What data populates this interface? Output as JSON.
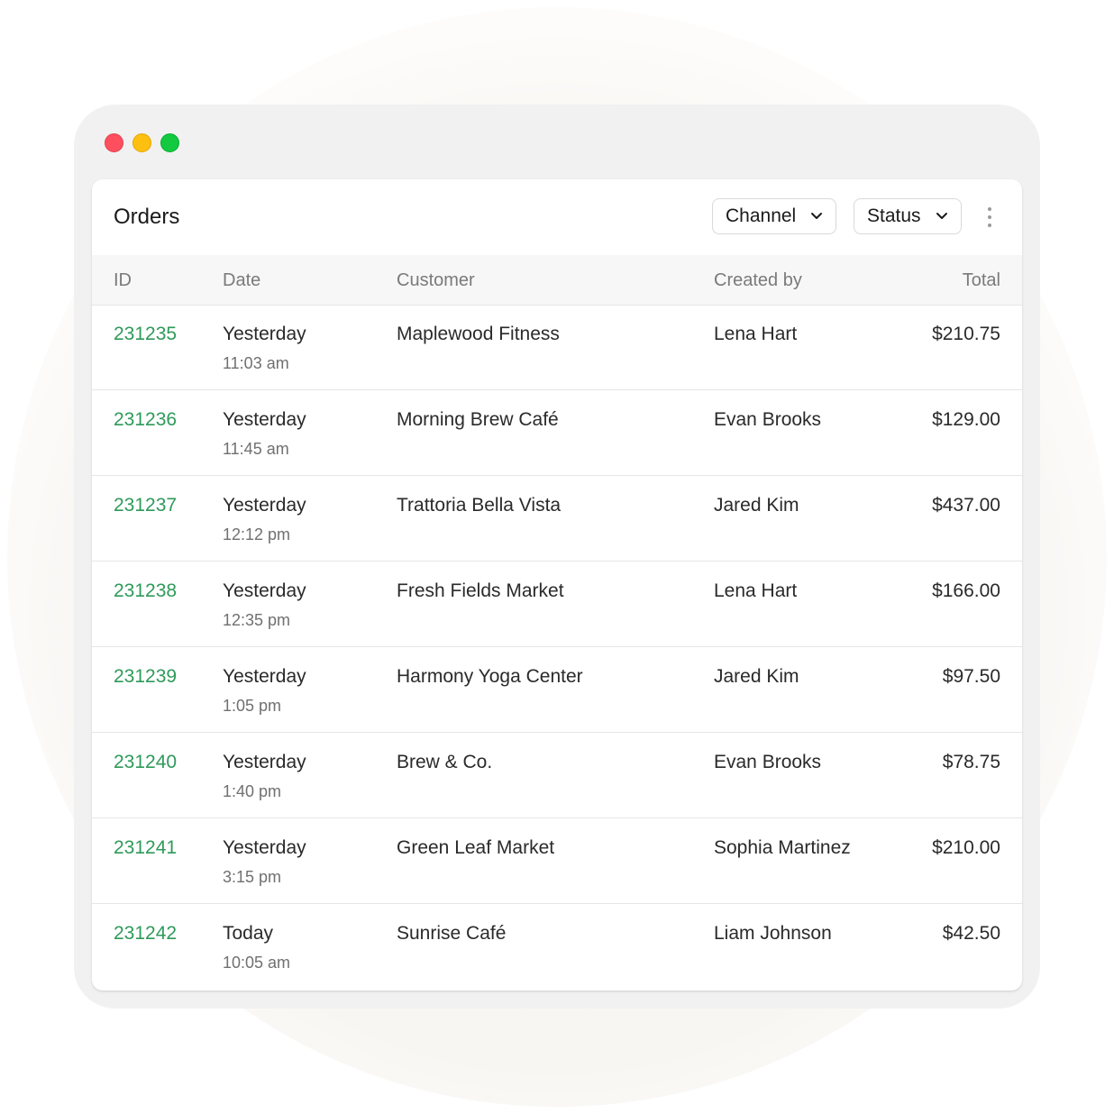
{
  "window": {
    "title": "Orders",
    "accent_color": "#2e9a5a"
  },
  "header": {
    "title": "Orders",
    "filters": [
      {
        "label": "Channel"
      },
      {
        "label": "Status"
      }
    ],
    "more_icon": "kebab-menu-icon"
  },
  "table": {
    "columns": [
      "ID",
      "Date",
      "Customer",
      "Created by",
      "Total"
    ],
    "rows": [
      {
        "id": "231235",
        "date": "Yesterday",
        "time": "11:03 am",
        "customer": "Maplewood Fitness",
        "created_by": "Lena Hart",
        "total": "$210.75"
      },
      {
        "id": "231236",
        "date": "Yesterday",
        "time": "11:45 am",
        "customer": "Morning Brew Café",
        "created_by": "Evan Brooks",
        "total": "$129.00"
      },
      {
        "id": "231237",
        "date": "Yesterday",
        "time": "12:12 pm",
        "customer": "Trattoria Bella Vista",
        "created_by": "Jared Kim",
        "total": "$437.00"
      },
      {
        "id": "231238",
        "date": "Yesterday",
        "time": "12:35 pm",
        "customer": "Fresh Fields Market",
        "created_by": "Lena Hart",
        "total": "$166.00"
      },
      {
        "id": "231239",
        "date": "Yesterday",
        "time": "1:05 pm",
        "customer": "Harmony Yoga Center",
        "created_by": "Jared Kim",
        "total": "$97.50"
      },
      {
        "id": "231240",
        "date": "Yesterday",
        "time": "1:40 pm",
        "customer": "Brew & Co.",
        "created_by": "Evan Brooks",
        "total": "$78.75"
      },
      {
        "id": "231241",
        "date": "Yesterday",
        "time": "3:15 pm",
        "customer": "Green Leaf Market",
        "created_by": "Sophia Martinez",
        "total": "$210.00"
      },
      {
        "id": "231242",
        "date": "Today",
        "time": "10:05 am",
        "customer": "Sunrise Café",
        "created_by": "Liam Johnson",
        "total": "$42.50"
      }
    ]
  }
}
